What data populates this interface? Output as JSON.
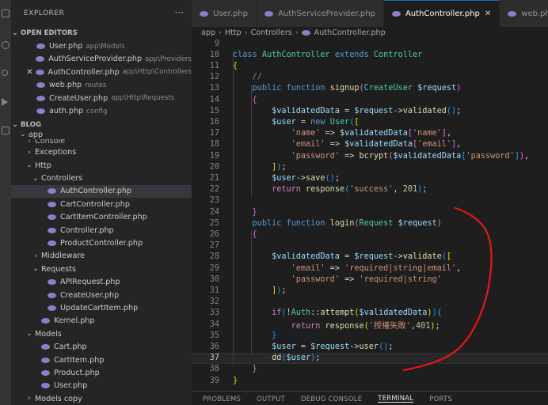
{
  "explorer": {
    "title": "EXPLORER",
    "more": "···",
    "open_editors_label": "OPEN EDITORS",
    "open_editors": [
      {
        "name": "User.php",
        "desc": "app\\Models"
      },
      {
        "name": "AuthServiceProvider.php",
        "desc": "app\\Providers"
      },
      {
        "name": "AuthController.php",
        "desc": "app\\Http\\Controllers",
        "active": true
      },
      {
        "name": "web.php",
        "desc": "routes"
      },
      {
        "name": "CreateUser.php",
        "desc": "app\\Http\\Requests"
      },
      {
        "name": "auth.php",
        "desc": "config"
      }
    ],
    "project_label": "BLOG",
    "tree": [
      {
        "label": "app",
        "type": "folder-open",
        "indent": 1
      },
      {
        "label": "Console",
        "type": "folder",
        "indent": 2
      },
      {
        "label": "Exceptions",
        "type": "folder",
        "indent": 2
      },
      {
        "label": "Http",
        "type": "folder-open",
        "indent": 2
      },
      {
        "label": "Controllers",
        "type": "folder-open",
        "indent": 3
      },
      {
        "label": "AuthController.php",
        "type": "file",
        "indent": 4,
        "active": true
      },
      {
        "label": "CartController.php",
        "type": "file",
        "indent": 4
      },
      {
        "label": "CartItemController.php",
        "type": "file",
        "indent": 4
      },
      {
        "label": "Controller.php",
        "type": "file",
        "indent": 4
      },
      {
        "label": "ProductController.php",
        "type": "file",
        "indent": 4
      },
      {
        "label": "Middleware",
        "type": "folder",
        "indent": 3
      },
      {
        "label": "Requests",
        "type": "folder-open",
        "indent": 3
      },
      {
        "label": "APIRequest.php",
        "type": "file",
        "indent": 4
      },
      {
        "label": "CreateUser.php",
        "type": "file",
        "indent": 4
      },
      {
        "label": "UpdateCartItem.php",
        "type": "file",
        "indent": 4
      },
      {
        "label": "Kernel.php",
        "type": "file",
        "indent": 3
      },
      {
        "label": "Models",
        "type": "folder-open",
        "indent": 2
      },
      {
        "label": "Cart.php",
        "type": "file",
        "indent": 3
      },
      {
        "label": "CartItem.php",
        "type": "file",
        "indent": 3
      },
      {
        "label": "Product.php",
        "type": "file",
        "indent": 3
      },
      {
        "label": "User.php",
        "type": "file",
        "indent": 3
      },
      {
        "label": "Models copy",
        "type": "folder",
        "indent": 2
      }
    ]
  },
  "tabs": [
    {
      "label": "User.php"
    },
    {
      "label": "AuthServiceProvider.php"
    },
    {
      "label": "AuthController.php",
      "active": true,
      "close": "✕"
    },
    {
      "label": "web.php"
    }
  ],
  "breadcrumb": [
    "app",
    "Http",
    "Controllers",
    "AuthController.php"
  ],
  "editor": {
    "current_line": 37,
    "lines": [
      {
        "n": 9,
        "tokens": []
      },
      {
        "n": 10,
        "tokens": [
          [
            "k",
            "class "
          ],
          [
            "t",
            "AuthController "
          ],
          [
            "k",
            "extends "
          ],
          [
            "t",
            "Controller"
          ]
        ]
      },
      {
        "n": 11,
        "tokens": [
          [
            "b1",
            "{"
          ]
        ]
      },
      {
        "n": 12,
        "tokens": [
          [
            "p",
            "    "
          ],
          [
            "c",
            "//"
          ]
        ]
      },
      {
        "n": 13,
        "tokens": [
          [
            "p",
            "    "
          ],
          [
            "k",
            "public function "
          ],
          [
            "f",
            "signup"
          ],
          [
            "b2",
            "("
          ],
          [
            "t",
            "CreateUser "
          ],
          [
            "v",
            "$request"
          ],
          [
            "b2",
            ")"
          ]
        ]
      },
      {
        "n": 14,
        "tokens": [
          [
            "p",
            "    "
          ],
          [
            "b2",
            "{"
          ]
        ]
      },
      {
        "n": 15,
        "tokens": [
          [
            "p",
            "        "
          ],
          [
            "v",
            "$validatedData"
          ],
          [
            "p",
            " = "
          ],
          [
            "v",
            "$request"
          ],
          [
            "p",
            "->"
          ],
          [
            "f",
            "validated"
          ],
          [
            "b3",
            "()"
          ],
          [
            "p",
            ";"
          ]
        ]
      },
      {
        "n": 16,
        "tokens": [
          [
            "p",
            "        "
          ],
          [
            "v",
            "$user"
          ],
          [
            "p",
            " = "
          ],
          [
            "k",
            "new "
          ],
          [
            "t",
            "User"
          ],
          [
            "b3",
            "("
          ],
          [
            "b1",
            "["
          ]
        ]
      },
      {
        "n": 17,
        "tokens": [
          [
            "p",
            "            "
          ],
          [
            "s",
            "'name'"
          ],
          [
            "p",
            " => "
          ],
          [
            "v",
            "$validatedData"
          ],
          [
            "b2",
            "["
          ],
          [
            "s",
            "'name'"
          ],
          [
            "b2",
            "]"
          ],
          [
            "p",
            ","
          ]
        ]
      },
      {
        "n": 18,
        "tokens": [
          [
            "p",
            "            "
          ],
          [
            "s",
            "'email'"
          ],
          [
            "p",
            " => "
          ],
          [
            "v",
            "$validatedData"
          ],
          [
            "b2",
            "["
          ],
          [
            "s",
            "'email'"
          ],
          [
            "b2",
            "]"
          ],
          [
            "p",
            ","
          ]
        ]
      },
      {
        "n": 19,
        "tokens": [
          [
            "p",
            "            "
          ],
          [
            "s",
            "'password'"
          ],
          [
            "p",
            " => "
          ],
          [
            "f",
            "bcrypt"
          ],
          [
            "b2",
            "("
          ],
          [
            "v",
            "$validatedData"
          ],
          [
            "b3",
            "["
          ],
          [
            "s",
            "'password'"
          ],
          [
            "b3",
            "]"
          ],
          [
            "b2",
            ")"
          ],
          [
            "p",
            ","
          ]
        ]
      },
      {
        "n": 20,
        "tokens": [
          [
            "p",
            "        "
          ],
          [
            "b1",
            "]"
          ],
          [
            "b3",
            ")"
          ],
          [
            "p",
            ";"
          ]
        ]
      },
      {
        "n": 21,
        "tokens": [
          [
            "p",
            "        "
          ],
          [
            "v",
            "$user"
          ],
          [
            "p",
            "->"
          ],
          [
            "f",
            "save"
          ],
          [
            "b3",
            "()"
          ],
          [
            "p",
            ";"
          ]
        ]
      },
      {
        "n": 22,
        "tokens": [
          [
            "p",
            "        "
          ],
          [
            "kc",
            "return "
          ],
          [
            "f",
            "response"
          ],
          [
            "b3",
            "("
          ],
          [
            "s",
            "'success'"
          ],
          [
            "p",
            ", "
          ],
          [
            "n",
            "201"
          ],
          [
            "b3",
            ")"
          ],
          [
            "p",
            ";"
          ]
        ]
      },
      {
        "n": 23,
        "tokens": []
      },
      {
        "n": 24,
        "tokens": [
          [
            "p",
            "    "
          ],
          [
            "b2",
            "}"
          ]
        ]
      },
      {
        "n": 25,
        "tokens": [
          [
            "p",
            "    "
          ],
          [
            "k",
            "public function "
          ],
          [
            "f",
            "login"
          ],
          [
            "b2",
            "("
          ],
          [
            "t",
            "Request "
          ],
          [
            "v",
            "$request"
          ],
          [
            "b2",
            ")"
          ]
        ]
      },
      {
        "n": 26,
        "tokens": [
          [
            "p",
            "    "
          ],
          [
            "b2",
            "{"
          ]
        ]
      },
      {
        "n": 27,
        "tokens": []
      },
      {
        "n": 28,
        "tokens": [
          [
            "p",
            "        "
          ],
          [
            "v",
            "$validatedData"
          ],
          [
            "p",
            " = "
          ],
          [
            "v",
            "$request"
          ],
          [
            "p",
            "->"
          ],
          [
            "f",
            "validate"
          ],
          [
            "b3",
            "("
          ],
          [
            "b1",
            "["
          ]
        ]
      },
      {
        "n": 29,
        "tokens": [
          [
            "p",
            "            "
          ],
          [
            "s",
            "'email'"
          ],
          [
            "p",
            " => "
          ],
          [
            "s",
            "'required|string|email'"
          ],
          [
            "p",
            ","
          ]
        ]
      },
      {
        "n": 30,
        "tokens": [
          [
            "p",
            "            "
          ],
          [
            "s",
            "'password'"
          ],
          [
            "p",
            " => "
          ],
          [
            "s",
            "'required|string'"
          ]
        ]
      },
      {
        "n": 31,
        "tokens": [
          [
            "p",
            "        "
          ],
          [
            "b1",
            "]"
          ],
          [
            "b3",
            ")"
          ],
          [
            "p",
            ";"
          ]
        ]
      },
      {
        "n": 32,
        "tokens": []
      },
      {
        "n": 33,
        "tokens": [
          [
            "p",
            "        "
          ],
          [
            "kc",
            "if"
          ],
          [
            "b3",
            "("
          ],
          [
            "p",
            "!"
          ],
          [
            "t",
            "Auth"
          ],
          [
            "p",
            "::"
          ],
          [
            "f",
            "attempt"
          ],
          [
            "b1",
            "("
          ],
          [
            "v",
            "$validatedData"
          ],
          [
            "b1",
            ")"
          ],
          [
            "b3",
            ")"
          ],
          [
            "b3",
            "{"
          ]
        ]
      },
      {
        "n": 34,
        "tokens": [
          [
            "p",
            "            "
          ],
          [
            "kc",
            "return "
          ],
          [
            "f",
            "response"
          ],
          [
            "b1",
            "("
          ],
          [
            "s",
            "'授權失敗'"
          ],
          [
            "p",
            ","
          ],
          [
            "n",
            "401"
          ],
          [
            "b1",
            ")"
          ],
          [
            "p",
            ";"
          ]
        ]
      },
      {
        "n": 35,
        "tokens": [
          [
            "p",
            "        "
          ],
          [
            "b3",
            "}"
          ]
        ]
      },
      {
        "n": 36,
        "tokens": [
          [
            "p",
            "        "
          ],
          [
            "v",
            "$user"
          ],
          [
            "p",
            " = "
          ],
          [
            "v",
            "$request"
          ],
          [
            "p",
            "->"
          ],
          [
            "f",
            "user"
          ],
          [
            "b3",
            "()"
          ],
          [
            "p",
            ";"
          ]
        ]
      },
      {
        "n": 37,
        "tokens": [
          [
            "p",
            "        "
          ],
          [
            "f",
            "dd"
          ],
          [
            "b3",
            "("
          ],
          [
            "v",
            "$user"
          ],
          [
            "b3",
            ")"
          ],
          [
            "p",
            ";"
          ]
        ]
      },
      {
        "n": 38,
        "tokens": [
          [
            "p",
            "    "
          ],
          [
            "b2",
            "}"
          ]
        ]
      },
      {
        "n": 39,
        "tokens": [
          [
            "b1",
            "}"
          ]
        ]
      }
    ]
  },
  "panel_tabs": [
    {
      "label": "PROBLEMS"
    },
    {
      "label": "OUTPUT"
    },
    {
      "label": "DEBUG CONSOLE"
    },
    {
      "label": "TERMINAL",
      "active": true
    },
    {
      "label": "PORTS"
    }
  ],
  "colors": {
    "annotation": "#e8141c",
    "accent": "#0e70c0",
    "php_icon": "#8a7fc9"
  }
}
